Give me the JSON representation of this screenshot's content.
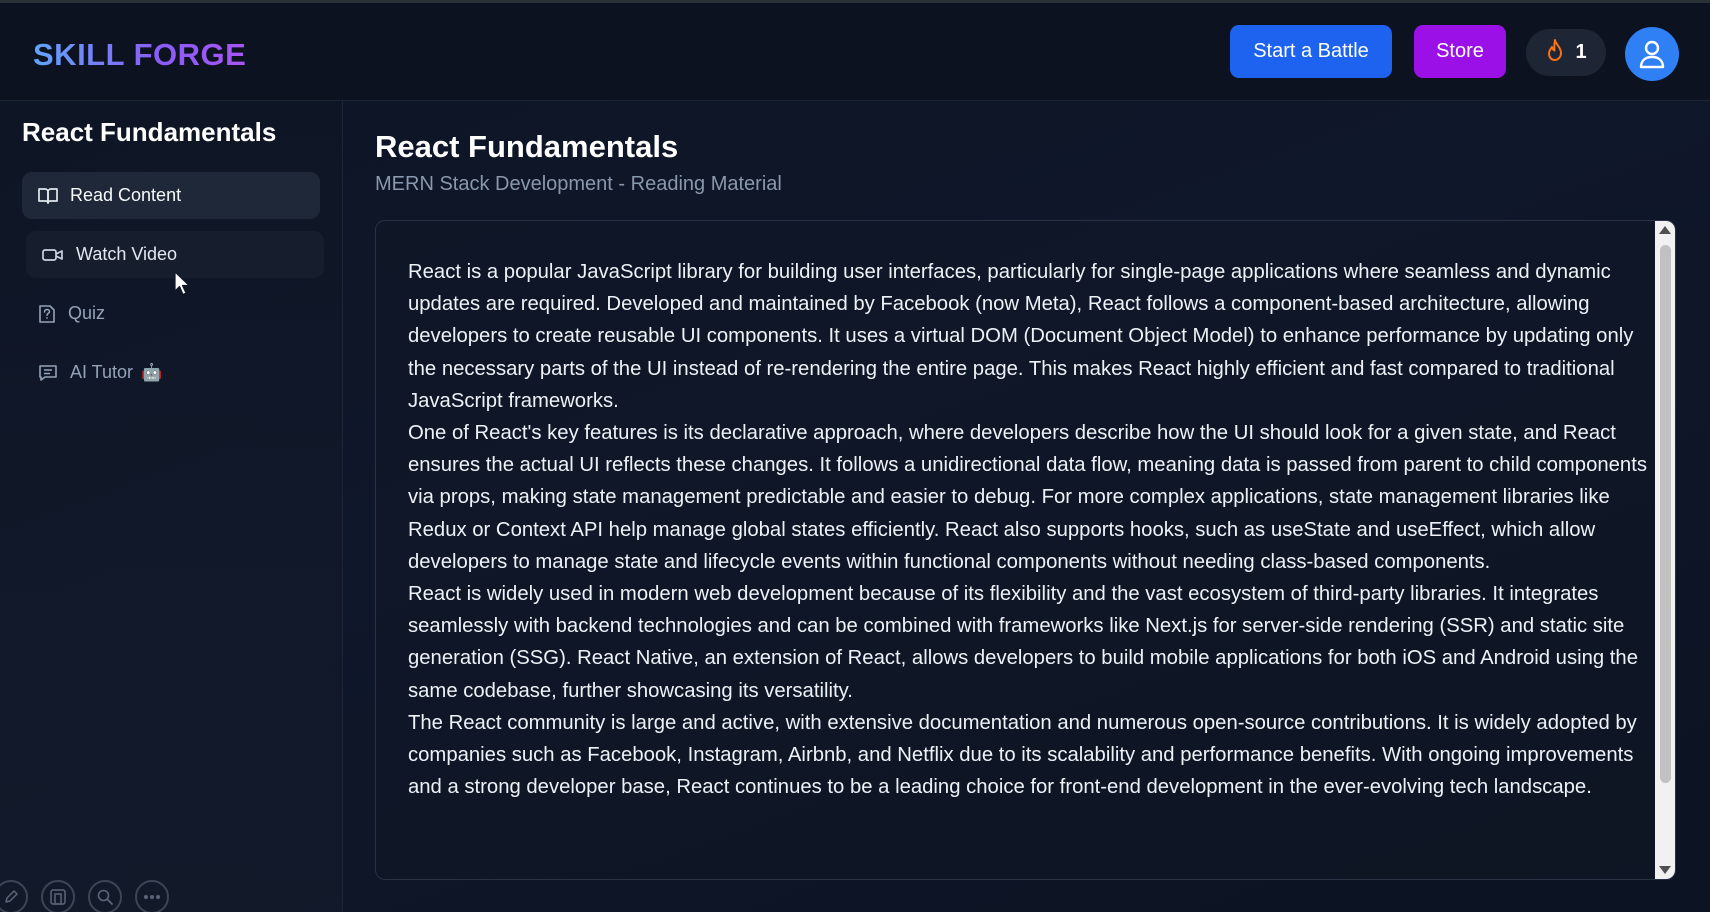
{
  "header": {
    "logo": "SKILL FORGE",
    "battle_label": "Start a Battle",
    "store_label": "Store",
    "streak_count": "1",
    "colors": {
      "battle": "#1d63f0",
      "store": "#9b10e6",
      "avatar": "#2f7ff5"
    }
  },
  "sidebar": {
    "title": "React Fundamentals",
    "items": [
      {
        "label": "Read Content",
        "icon": "book-open-icon",
        "state": "active"
      },
      {
        "label": "Watch Video",
        "icon": "video-icon",
        "state": "hover"
      },
      {
        "label": "Quiz",
        "icon": "quiz-icon",
        "state": "default"
      },
      {
        "label": "AI Tutor",
        "icon": "chat-icon",
        "emoji": "🤖",
        "state": "default"
      }
    ],
    "tools": [
      "pen-icon",
      "layout-icon",
      "search-icon",
      "more-icon"
    ]
  },
  "main": {
    "title": "React Fundamentals",
    "subtitle": "MERN Stack Development - Reading Material",
    "paragraphs": [
      "React is a popular JavaScript library for building user interfaces, particularly for single-page applications where seamless and dynamic updates are required. Developed and maintained by Facebook (now Meta), React follows a component-based architecture, allowing developers to create reusable UI components. It uses a virtual DOM (Document Object Model) to enhance performance by updating only the necessary parts of the UI instead of re-rendering the entire page. This makes React highly efficient and fast compared to traditional JavaScript frameworks.",
      "One of React's key features is its declarative approach, where developers describe how the UI should look for a given state, and React ensures the actual UI reflects these changes. It follows a unidirectional data flow, meaning data is passed from parent to child components via props, making state management predictable and easier to debug. For more complex applications, state management libraries like Redux or Context API help manage global states efficiently. React also supports hooks, such as useState and useEffect, which allow developers to manage state and lifecycle events within functional components without needing class-based components.",
      "React is widely used in modern web development because of its flexibility and the vast ecosystem of third-party libraries. It integrates seamlessly with backend technologies and can be combined with frameworks like Next.js for server-side rendering (SSR) and static site generation (SSG). React Native, an extension of React, allows developers to build mobile applications for both iOS and Android using the same codebase, further showcasing its versatility.",
      "The React community is large and active, with extensive documentation and numerous open-source contributions. It is widely adopted by companies such as Facebook, Instagram, Airbnb, and Netflix due to its scalability and performance benefits. With ongoing improvements and a strong developer base, React continues to be a leading choice for front-end development in the ever-evolving tech landscape."
    ]
  }
}
